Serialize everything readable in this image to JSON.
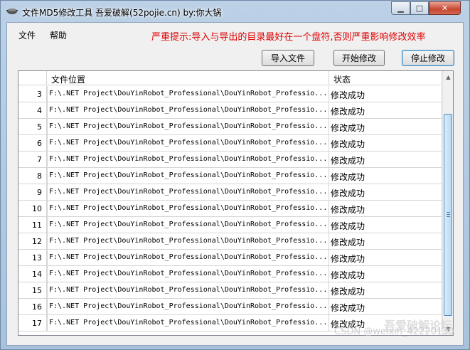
{
  "window": {
    "title": "文件MD5修改工具  吾爱破解(52pojie.cn)   by:你大锅",
    "minimize_label": "▁",
    "maximize_label": "□",
    "close_label": "✕"
  },
  "menu": {
    "file": "文件",
    "help": "帮助"
  },
  "notice": "严重提示:导入与导出的目录最好在一个盘符,否则严重影响修改效率",
  "toolbar": {
    "import_label": "导入文件",
    "start_label": "开始修改",
    "stop_label": "停止修改"
  },
  "grid": {
    "headers": {
      "num": "",
      "path": "文件位置",
      "status": "状态"
    },
    "rows": [
      {
        "num": "3",
        "path": "F:\\.NET Project\\DouYinRobot_Professional\\DouYinRobot_Professio...",
        "status": "修改成功"
      },
      {
        "num": "4",
        "path": "F:\\.NET Project\\DouYinRobot_Professional\\DouYinRobot_Professio...",
        "status": "修改成功"
      },
      {
        "num": "5",
        "path": "F:\\.NET Project\\DouYinRobot_Professional\\DouYinRobot_Professio...",
        "status": "修改成功"
      },
      {
        "num": "6",
        "path": "F:\\.NET Project\\DouYinRobot_Professional\\DouYinRobot_Professio...",
        "status": "修改成功"
      },
      {
        "num": "7",
        "path": "F:\\.NET Project\\DouYinRobot_Professional\\DouYinRobot_Professio...",
        "status": "修改成功"
      },
      {
        "num": "8",
        "path": "F:\\.NET Project\\DouYinRobot_Professional\\DouYinRobot_Professio...",
        "status": "修改成功"
      },
      {
        "num": "9",
        "path": "F:\\.NET Project\\DouYinRobot_Professional\\DouYinRobot_Professio...",
        "status": "修改成功"
      },
      {
        "num": "10",
        "path": "F:\\.NET Project\\DouYinRobot_Professional\\DouYinRobot_Professio...",
        "status": "修改成功"
      },
      {
        "num": "11",
        "path": "F:\\.NET Project\\DouYinRobot_Professional\\DouYinRobot_Professio...",
        "status": "修改成功"
      },
      {
        "num": "12",
        "path": "F:\\.NET Project\\DouYinRobot_Professional\\DouYinRobot_Professio...",
        "status": "修改成功"
      },
      {
        "num": "13",
        "path": "F:\\.NET Project\\DouYinRobot_Professional\\DouYinRobot_Professio...",
        "status": "修改成功"
      },
      {
        "num": "14",
        "path": "F:\\.NET Project\\DouYinRobot_Professional\\DouYinRobot_Professio...",
        "status": "修改成功"
      },
      {
        "num": "15",
        "path": "F:\\.NET Project\\DouYinRobot_Professional\\DouYinRobot_Professio...",
        "status": "修改成功"
      },
      {
        "num": "16",
        "path": "F:\\.NET Project\\DouYinRobot_Professional\\DouYinRobot_Professio...",
        "status": "修改成功"
      },
      {
        "num": "17",
        "path": "F:\\.NET Project\\DouYinRobot_Professional\\DouYinRobot_Professio...",
        "status": "修改成功"
      }
    ]
  },
  "watermark": {
    "forum": "吾爱破解论坛",
    "csdn": "CSDN @weixin_42220130"
  },
  "icons": {
    "app": "pot-icon",
    "scroll_up": "scroll-up-arrow-icon",
    "scroll_down": "scroll-down-arrow-icon"
  },
  "colors": {
    "notice": "#e00000",
    "close_button": "#c7452e",
    "scroll_thumb": "#b7d9f4"
  }
}
